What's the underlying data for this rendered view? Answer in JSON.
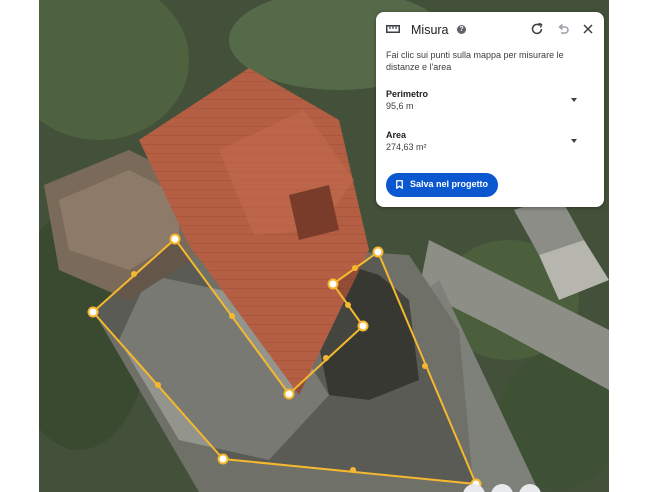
{
  "panel": {
    "title": "Misura",
    "help_icon_glyph": "?",
    "instructions": "Fai clic sui punti sulla mappa per misurare le distanze e l'area",
    "perimeter": {
      "label": "Perimetro",
      "value": "95,6 m"
    },
    "area": {
      "label": "Area",
      "value": "274,63 m²"
    },
    "save_label": "Salva nel progetto",
    "icons": [
      "ruler-icon",
      "help-icon",
      "redo-icon",
      "undo-icon",
      "close-icon",
      "chevron-down-icon",
      "bookmark-icon"
    ]
  },
  "colors": {
    "accent": "#0b57d0",
    "measure_line": "#f5b82e",
    "panel_bg": "#ffffff",
    "text": "#202124"
  }
}
